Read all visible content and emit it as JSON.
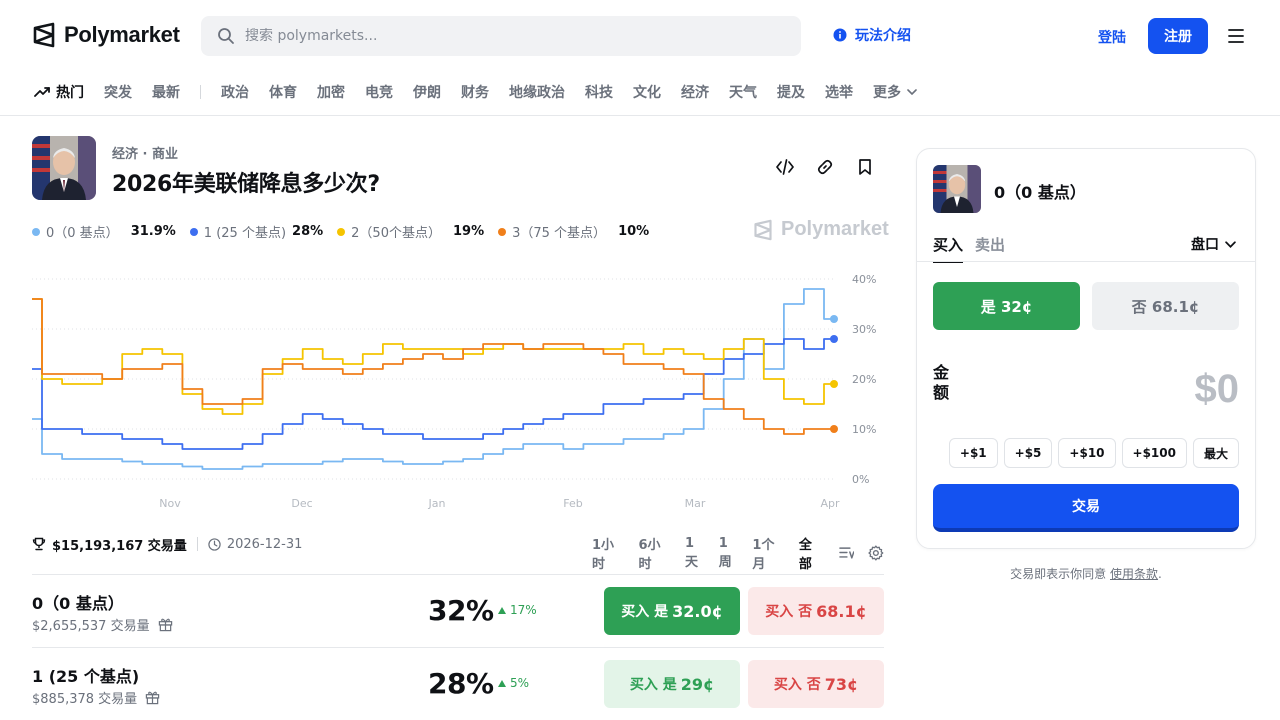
{
  "header": {
    "brand": "Polymarket",
    "search_placeholder": "搜索 polymarkets...",
    "howto_label": "玩法介绍",
    "login_label": "登陆",
    "signup_label": "注册"
  },
  "nav": {
    "items": [
      {
        "label": "热门"
      },
      {
        "label": "突发"
      },
      {
        "label": "最新"
      },
      {
        "label": "政治"
      },
      {
        "label": "体育"
      },
      {
        "label": "加密"
      },
      {
        "label": "电竞"
      },
      {
        "label": "伊朗"
      },
      {
        "label": "财务"
      },
      {
        "label": "地缘政治"
      },
      {
        "label": "科技"
      },
      {
        "label": "文化"
      },
      {
        "label": "经济"
      },
      {
        "label": "天气"
      },
      {
        "label": "提及"
      },
      {
        "label": "选举"
      },
      {
        "label": "更多"
      }
    ]
  },
  "market": {
    "category": "经济 · 商业",
    "title": "2026年美联储降息多少次?",
    "watermark": "Polymarket",
    "legend": [
      {
        "label": "0（0 基点）",
        "value": "31.9%",
        "color": "#7ab8f2"
      },
      {
        "label": "1 (25 个基点)",
        "value": "28%",
        "color": "#3d6ef0"
      },
      {
        "label": "2（50个基点）",
        "value": "19%",
        "color": "#f5c400"
      },
      {
        "label": "3（75 个基点）",
        "value": "10%",
        "color": "#f07f1a"
      }
    ],
    "volume": "$15,193,167 交易量",
    "end_date": "2026-12-31",
    "ranges": [
      {
        "label": "1小时"
      },
      {
        "label": "6小时"
      },
      {
        "label": "1天"
      },
      {
        "label": "1周"
      },
      {
        "label": "1个月"
      },
      {
        "label": "全部"
      }
    ],
    "active_range": "全部"
  },
  "chart_data": {
    "type": "line",
    "x_ticks": [
      "Nov",
      "Dec",
      "Jan",
      "Feb",
      "Mar",
      "Apr"
    ],
    "y_ticks": [
      "40%",
      "30%",
      "20%",
      "10%",
      "0%"
    ],
    "ylim": [
      0,
      40
    ],
    "grid": true,
    "series": [
      {
        "name": "0（0 基点）",
        "color": "#7ab8f2",
        "values": [
          12,
          5,
          4,
          4,
          4,
          3.5,
          3,
          3,
          2.5,
          2,
          2,
          2.5,
          3,
          3,
          3,
          3.5,
          4,
          4,
          3.5,
          3,
          3,
          3.5,
          4,
          5,
          6,
          7,
          7,
          6,
          7,
          7,
          8,
          8,
          9,
          10,
          14,
          20,
          28,
          22,
          35,
          38,
          32
        ]
      },
      {
        "name": "1 (25 个基点)",
        "color": "#3d6ef0",
        "values": [
          22,
          10,
          10,
          9,
          9,
          8,
          8,
          7,
          6,
          6,
          6,
          7,
          9,
          11,
          13,
          12,
          11,
          10,
          9,
          9,
          8,
          8,
          8,
          9,
          10,
          11,
          12,
          13,
          13,
          15,
          15,
          16,
          16,
          17,
          21,
          24,
          25,
          27,
          28,
          26,
          28
        ]
      },
      {
        "name": "2（50个基点）",
        "color": "#f5c400",
        "values": [
          36,
          20,
          19,
          19,
          20,
          25,
          26,
          25,
          17,
          14,
          13,
          15,
          21,
          24,
          26,
          24,
          23,
          25,
          27,
          26,
          26,
          26,
          25,
          26,
          27,
          26,
          26,
          26,
          26,
          26,
          27,
          25,
          26,
          25,
          24,
          26,
          28,
          20,
          16,
          15,
          19
        ]
      },
      {
        "name": "3（75 个基点）",
        "color": "#f07f1a",
        "values": [
          36,
          21,
          21,
          21,
          20,
          22,
          22,
          23,
          18,
          15,
          15,
          16,
          22,
          23,
          22,
          22,
          21,
          22,
          23,
          24,
          25,
          24,
          26,
          27,
          27,
          26,
          27,
          27,
          26,
          25,
          23,
          23,
          22,
          21,
          16,
          14,
          12,
          10,
          9,
          10,
          10
        ]
      }
    ]
  },
  "outcomes": [
    {
      "name": "0（0 基点）",
      "volume": "$2,655,537 交易量",
      "pct": "32%",
      "change": "17%",
      "yes_prefix": "买入 是",
      "yes_price": "32.0¢",
      "no_prefix": "买入 否",
      "no_price": "68.1¢"
    },
    {
      "name": "1 (25 个基点)",
      "volume": "$885,378 交易量",
      "pct": "28%",
      "change": "5%",
      "yes_prefix": "买入 是",
      "yes_price": "29¢",
      "no_prefix": "买入 否",
      "no_price": "73¢"
    }
  ],
  "panel": {
    "title": "0（0 基点）",
    "tab_buy": "买入",
    "tab_sell": "卖出",
    "order_type": "盘口",
    "yes_label": "是 32¢",
    "no_label": "否 68.1¢",
    "amount_label": "金额",
    "amount_value": "$0",
    "quick": [
      {
        "label": "+$1"
      },
      {
        "label": "+$5"
      },
      {
        "label": "+$10"
      },
      {
        "label": "+$100"
      },
      {
        "label": "最大"
      }
    ],
    "trade_label": "交易",
    "terms_prefix": "交易即表示你同意",
    "terms_link": "使用条款",
    "terms_suffix": "."
  }
}
